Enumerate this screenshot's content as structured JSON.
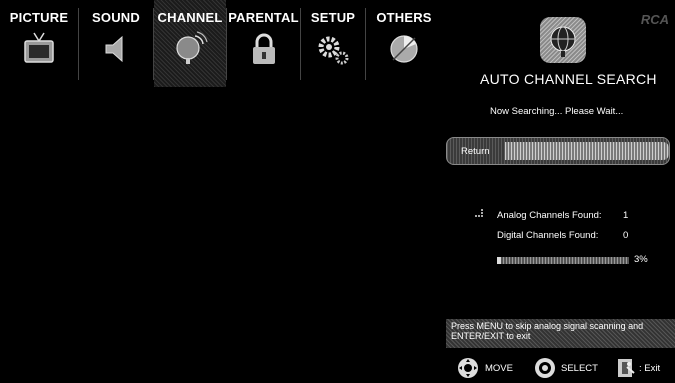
{
  "menu": {
    "items": [
      {
        "label": "PICTURE",
        "icon": "tv-icon"
      },
      {
        "label": "SOUND",
        "icon": "speaker-icon"
      },
      {
        "label": "CHANNEL",
        "icon": "satellite-dish-icon",
        "active": true
      },
      {
        "label": "PARENTAL",
        "icon": "lock-icon"
      },
      {
        "label": "SETUP",
        "icon": "gears-icon"
      },
      {
        "label": "OTHERS",
        "icon": "pie-chart-icon"
      }
    ]
  },
  "header": {
    "brand": "RCA",
    "title": "AUTO CHANNEL SEARCH",
    "title_icon": "globe-dish-icon"
  },
  "status": {
    "text": "Now Searching... Please Wait..."
  },
  "return_button": {
    "label": "Return"
  },
  "results": {
    "analog_label": "Analog Channels Found:",
    "analog_value": "1",
    "digital_label": "Digital Channels Found:",
    "digital_value": "0",
    "indicator_icon": "antenna-small-icon"
  },
  "progress": {
    "value": 0.03,
    "label": "3%"
  },
  "hint": {
    "text": "Press MENU to skip analog signal scanning and ENTER/EXIT to exit"
  },
  "footer": {
    "move": "MOVE",
    "select": "SELECT",
    "exit": ": Exit"
  },
  "colors": {
    "background": "#000000",
    "text": "#ffffff",
    "panel_gray": "#444444"
  }
}
